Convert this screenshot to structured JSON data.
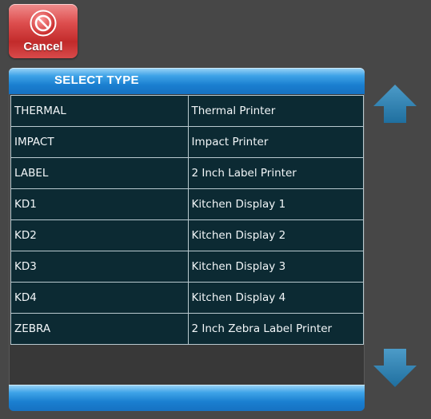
{
  "cancel_button": {
    "label": "Cancel",
    "icon": "no-entry-icon"
  },
  "panel": {
    "title": "SELECT TYPE"
  },
  "rows": [
    {
      "code": "THERMAL",
      "description": "Thermal Printer"
    },
    {
      "code": "IMPACT",
      "description": "Impact Printer"
    },
    {
      "code": "LABEL",
      "description": "2 Inch Label Printer"
    },
    {
      "code": "KD1",
      "description": "Kitchen Display 1"
    },
    {
      "code": "KD2",
      "description": "Kitchen Display 2"
    },
    {
      "code": "KD3",
      "description": "Kitchen Display 3"
    },
    {
      "code": "KD4",
      "description": "Kitchen Display 4"
    },
    {
      "code": "ZEBRA",
      "description": "2 Inch Zebra Label Printer"
    }
  ],
  "scroll": {
    "up_icon": "arrow-up-icon",
    "down_icon": "arrow-down-icon"
  },
  "colors": {
    "header_blue": "#1a7fd0",
    "cell_bg": "#0c2a33",
    "cancel_red": "#c22b2b",
    "arrow_blue": "#2b7cab"
  }
}
